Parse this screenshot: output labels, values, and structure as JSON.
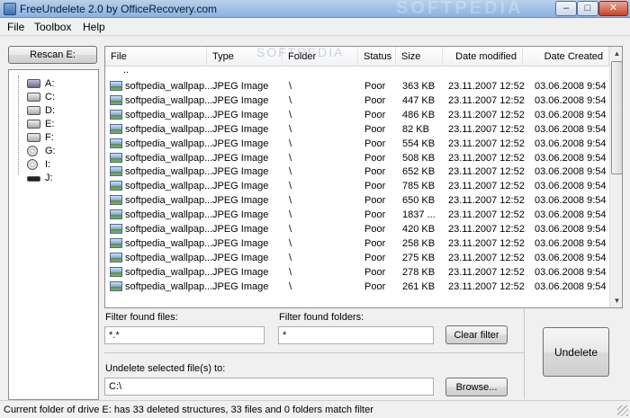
{
  "window": {
    "title": "FreeUndelete 2.0 by OfficeRecovery.com",
    "watermark": "SOFTPEDIA"
  },
  "menu": [
    "File",
    "Toolbox",
    "Help"
  ],
  "rescan_button": "Rescan E:",
  "drives": [
    {
      "label": "A:",
      "icon": "floppy-drive-icon"
    },
    {
      "label": "C:",
      "icon": "hard-drive-icon"
    },
    {
      "label": "D:",
      "icon": "hard-drive-icon"
    },
    {
      "label": "E:",
      "icon": "hard-drive-icon"
    },
    {
      "label": "F:",
      "icon": "hard-drive-icon"
    },
    {
      "label": "G:",
      "icon": "cd-drive-icon"
    },
    {
      "label": "I:",
      "icon": "cd-drive-icon"
    },
    {
      "label": "J:",
      "icon": "usb-drive-icon"
    }
  ],
  "table": {
    "watermark": "SOFTPEDIA",
    "columns": [
      "File",
      "Type",
      "Folder",
      "Status",
      "Size",
      "Date modified",
      "Date Created"
    ],
    "parent_row": "..",
    "rows": [
      [
        "softpedia_wallpap...",
        "JPEG Image",
        "\\",
        "Poor",
        "363 KB",
        "23.11.2007 12:52",
        "03.06.2008  9:54"
      ],
      [
        "softpedia_wallpap...",
        "JPEG Image",
        "\\",
        "Poor",
        "447 KB",
        "23.11.2007 12:52",
        "03.06.2008  9:54"
      ],
      [
        "softpedia_wallpap...",
        "JPEG Image",
        "\\",
        "Poor",
        "486 KB",
        "23.11.2007 12:52",
        "03.06.2008  9:54"
      ],
      [
        "softpedia_wallpap...",
        "JPEG Image",
        "\\",
        "Poor",
        "82 KB",
        "23.11.2007 12:52",
        "03.06.2008  9:54"
      ],
      [
        "softpedia_wallpap...",
        "JPEG Image",
        "\\",
        "Poor",
        "554 KB",
        "23.11.2007 12:52",
        "03.06.2008  9:54"
      ],
      [
        "softpedia_wallpap...",
        "JPEG Image",
        "\\",
        "Poor",
        "508 KB",
        "23.11.2007 12:52",
        "03.06.2008  9:54"
      ],
      [
        "softpedia_wallpap...",
        "JPEG Image",
        "\\",
        "Poor",
        "652 KB",
        "23.11.2007 12:52",
        "03.06.2008  9:54"
      ],
      [
        "softpedia_wallpap...",
        "JPEG Image",
        "\\",
        "Poor",
        "785 KB",
        "23.11.2007 12:52",
        "03.06.2008  9:54"
      ],
      [
        "softpedia_wallpap...",
        "JPEG Image",
        "\\",
        "Poor",
        "650 KB",
        "23.11.2007 12:52",
        "03.06.2008  9:54"
      ],
      [
        "softpedia_wallpap...",
        "JPEG Image",
        "\\",
        "Poor",
        "1837 ...",
        "23.11.2007 12:52",
        "03.06.2008  9:54"
      ],
      [
        "softpedia_wallpap...",
        "JPEG Image",
        "\\",
        "Poor",
        "420 KB",
        "23.11.2007 12:52",
        "03.06.2008  9:54"
      ],
      [
        "softpedia_wallpap...",
        "JPEG Image",
        "\\",
        "Poor",
        "258 KB",
        "23.11.2007 12:52",
        "03.06.2008  9:54"
      ],
      [
        "softpedia_wallpap...",
        "JPEG Image",
        "\\",
        "Poor",
        "275 KB",
        "23.11.2007 12:52",
        "03.06.2008  9:54"
      ],
      [
        "softpedia_wallpap...",
        "JPEG Image",
        "\\",
        "Poor",
        "278 KB",
        "23.11.2007 12:52",
        "03.06.2008  9:54"
      ],
      [
        "softpedia_wallpap...",
        "JPEG Image",
        "\\",
        "Poor",
        "261 KB",
        "23.11.2007 12:52",
        "03.06.2008  9:54"
      ]
    ]
  },
  "filters": {
    "files_label": "Filter found files:",
    "files_value": "*.*",
    "folders_label": "Filter found folders:",
    "folders_value": "*",
    "clear_button": "Clear filter"
  },
  "undelete": {
    "dest_label": "Undelete selected file(s) to:",
    "dest_value": "C:\\",
    "browse_button": "Browse...",
    "undelete_button": "Undelete"
  },
  "status": "Current folder of drive E: has 33 deleted structures, 33 files and 0 folders match filter"
}
